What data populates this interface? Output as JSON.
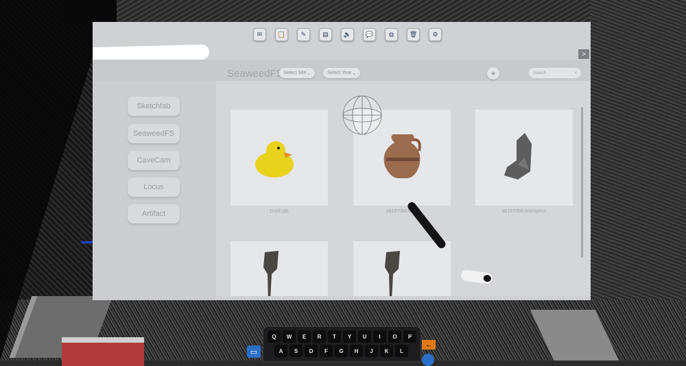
{
  "toolbar": {
    "icons": [
      "mail-icon",
      "clipboard-icon",
      "edit-icon",
      "document-icon",
      "volume-icon",
      "chat-icon",
      "globe-icon",
      "trash-icon",
      "settings-icon"
    ],
    "glyphs": [
      "✉",
      "📋",
      "✎",
      "▤",
      "🔈",
      "💬",
      "◍",
      "🗑",
      "⚙"
    ]
  },
  "collapse": {
    "label": ">"
  },
  "sidebar": {
    "items": [
      {
        "label": "Sketchfab"
      },
      {
        "label": "SeaweedFS"
      },
      {
        "label": "CaveCam"
      },
      {
        "label": "Locus"
      },
      {
        "label": "Artifact"
      }
    ]
  },
  "header": {
    "title": "SeaweedFS",
    "filters": [
      {
        "label": "Select Site",
        "caret": "⌄"
      },
      {
        "label": "Select Year",
        "caret": "⌄"
      }
    ],
    "add_label": "+",
    "search_placeholder": "Search",
    "search_clear": "×"
  },
  "cards": [
    {
      "label": "Duck.glb",
      "model": "rubber-duck"
    },
    {
      "label": "ab1970b8-d-…",
      "model": "clay-vase"
    },
    {
      "label": "ab1970b8-inscription",
      "model": "stone-fragment"
    },
    {
      "label": "",
      "model": "rock-column"
    },
    {
      "label": "",
      "model": "rock-column"
    }
  ],
  "keyboard": {
    "row1": [
      "Q",
      "W",
      "E",
      "R",
      "T",
      "Y",
      "U",
      "I",
      "O",
      "P"
    ],
    "row2": [
      "A",
      "S",
      "D",
      "F",
      "G",
      "H",
      "J",
      "K",
      "L"
    ],
    "back_glyph": "←"
  },
  "colors": {
    "panel": "#d6d8dc",
    "accent_orange": "#e07a14",
    "accent_blue": "#2a70c8"
  }
}
